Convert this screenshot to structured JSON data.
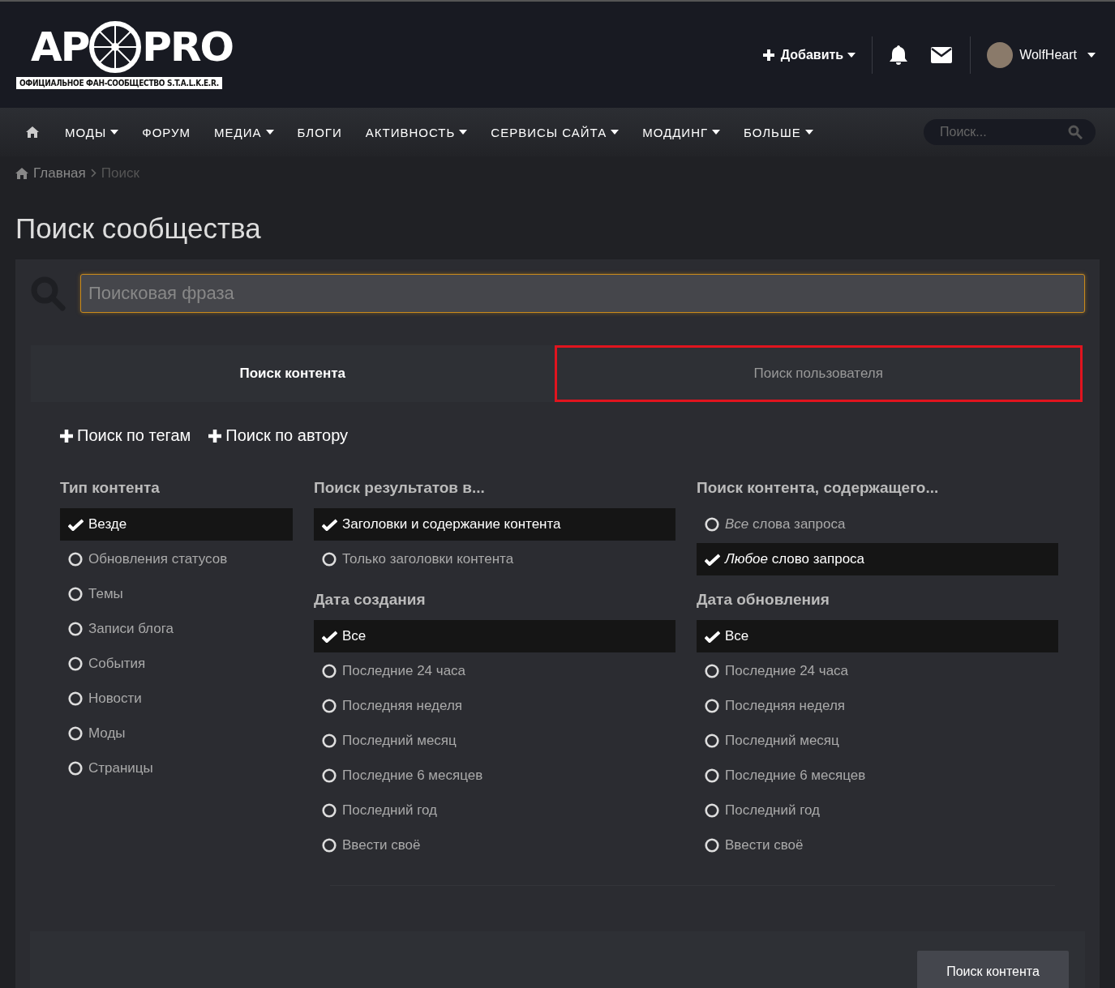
{
  "header": {
    "logo": {
      "title_left": "AP",
      "title_right": "PRO",
      "subtitle": "ОФИЦИАЛЬНОЕ ФАН-СООБЩЕСТВО S.T.A.L.K.E.R."
    },
    "add_button": "Добавить",
    "user_name": "WolfHeart"
  },
  "nav": {
    "items": [
      {
        "label": "МОДЫ",
        "dropdown": true
      },
      {
        "label": "ФОРУМ",
        "dropdown": false
      },
      {
        "label": "МЕДИА",
        "dropdown": true
      },
      {
        "label": "БЛОГИ",
        "dropdown": false
      },
      {
        "label": "АКТИВНОСТЬ",
        "dropdown": true
      },
      {
        "label": "СЕРВИСЫ САЙТА",
        "dropdown": true
      },
      {
        "label": "МОДДИНГ",
        "dropdown": true
      },
      {
        "label": "БОЛЬШЕ",
        "dropdown": true
      }
    ],
    "search_placeholder": "Поиск..."
  },
  "breadcrumb": [
    "Главная",
    "Поиск"
  ],
  "page_title": "Поиск сообщества",
  "search": {
    "placeholder": "Поисковая фраза"
  },
  "tabs": [
    {
      "label": "Поиск контента",
      "selected": true,
      "highlighted": false
    },
    {
      "label": "Поиск пользователя",
      "selected": false,
      "highlighted": true
    }
  ],
  "filter_links": [
    "Поиск по тегам",
    "Поиск по автору"
  ],
  "columns": [
    {
      "groups": [
        {
          "title": "Тип контента",
          "options": [
            {
              "label": "Везде",
              "selected": true
            },
            {
              "label": "Обновления статусов",
              "selected": false
            },
            {
              "label": "Темы",
              "selected": false
            },
            {
              "label": "Записи блога",
              "selected": false
            },
            {
              "label": "События",
              "selected": false
            },
            {
              "label": "Новости",
              "selected": false
            },
            {
              "label": "Моды",
              "selected": false
            },
            {
              "label": "Страницы",
              "selected": false
            }
          ]
        }
      ]
    },
    {
      "groups": [
        {
          "title": "Поиск результатов в...",
          "options": [
            {
              "label": "Заголовки и содержание контента",
              "selected": true
            },
            {
              "label": "Только заголовки контента",
              "selected": false
            }
          ]
        },
        {
          "title": "Дата создания",
          "options": [
            {
              "label": "Все",
              "selected": true
            },
            {
              "label": "Последние 24 часа",
              "selected": false
            },
            {
              "label": "Последняя неделя",
              "selected": false
            },
            {
              "label": "Последний месяц",
              "selected": false
            },
            {
              "label": "Последние 6 месяцев",
              "selected": false
            },
            {
              "label": "Последний год",
              "selected": false
            },
            {
              "label": "Ввести своё",
              "selected": false
            }
          ]
        }
      ]
    },
    {
      "groups": [
        {
          "title": "Поиск контента, содержащего...",
          "options": [
            {
              "label": "*Все* слова запроса",
              "selected": false
            },
            {
              "label": "*Любое* слово запроса",
              "selected": true
            }
          ]
        },
        {
          "title": "Дата обновления",
          "options": [
            {
              "label": "Все",
              "selected": true
            },
            {
              "label": "Последние 24 часа",
              "selected": false
            },
            {
              "label": "Последняя неделя",
              "selected": false
            },
            {
              "label": "Последний месяц",
              "selected": false
            },
            {
              "label": "Последние 6 месяцев",
              "selected": false
            },
            {
              "label": "Последний год",
              "selected": false
            },
            {
              "label": "Ввести своё",
              "selected": false
            }
          ]
        }
      ]
    }
  ],
  "submit_button": "Поиск контента"
}
